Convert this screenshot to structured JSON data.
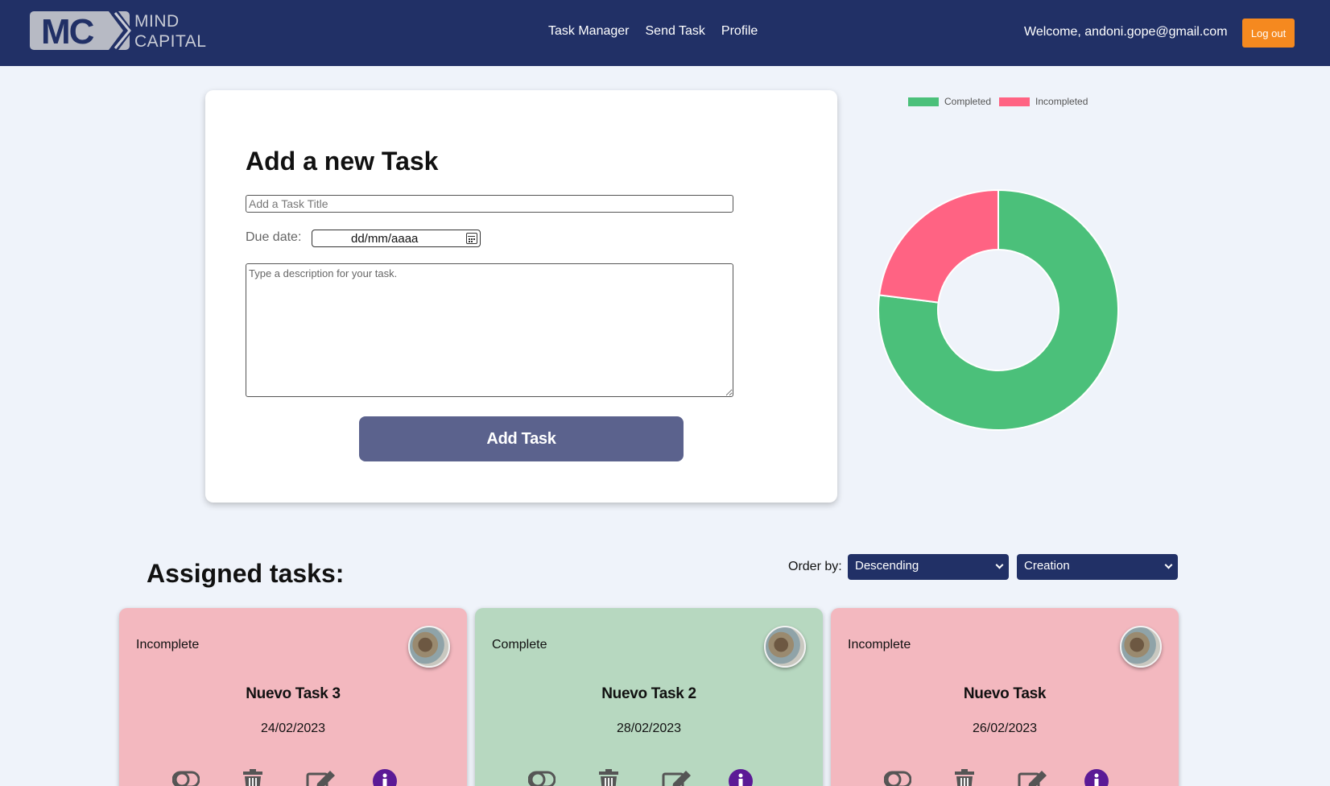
{
  "header": {
    "logo": {
      "badge": "MC",
      "line1": "MIND",
      "line2": "CAPITAL"
    },
    "nav": [
      "Task Manager",
      "Send Task",
      "Profile"
    ],
    "welcome": "Welcome, andoni.gope@gmail.com",
    "logout_label": "Log out",
    "background": "#213066",
    "logout_color": "#f5891f"
  },
  "form": {
    "title": "Add a new Task",
    "title_placeholder": "Add a Task Title",
    "due_label": "Due date:",
    "date_value": "dd/mm/aaaa",
    "description_placeholder": "Type a description for your task.",
    "submit_label": "Add Task"
  },
  "chart_data": {
    "type": "pie",
    "style": "doughnut",
    "categories": [
      "Completed",
      "Incompleted"
    ],
    "values": [
      77,
      23
    ],
    "colors": [
      "#4bc07a",
      "#ff6383"
    ],
    "legend_position": "top"
  },
  "assigned": {
    "title": "Assigned tasks:",
    "order_label": "Order by:",
    "order_direction": "Descending",
    "order_field": "Creation",
    "tasks": [
      {
        "status": "Incomplete",
        "name": "Nuevo Task 3",
        "date": "24/02/2023",
        "color": "#f3b8bf"
      },
      {
        "status": "Complete",
        "name": "Nuevo Task 2",
        "date": "28/02/2023",
        "color": "#b7d8c0"
      },
      {
        "status": "Incomplete",
        "name": "Nuevo Task",
        "date": "26/02/2023",
        "color": "#f3b8bf"
      }
    ],
    "action_icons": [
      "toggle-icon",
      "trash-icon",
      "edit-icon",
      "info-icon"
    ]
  }
}
